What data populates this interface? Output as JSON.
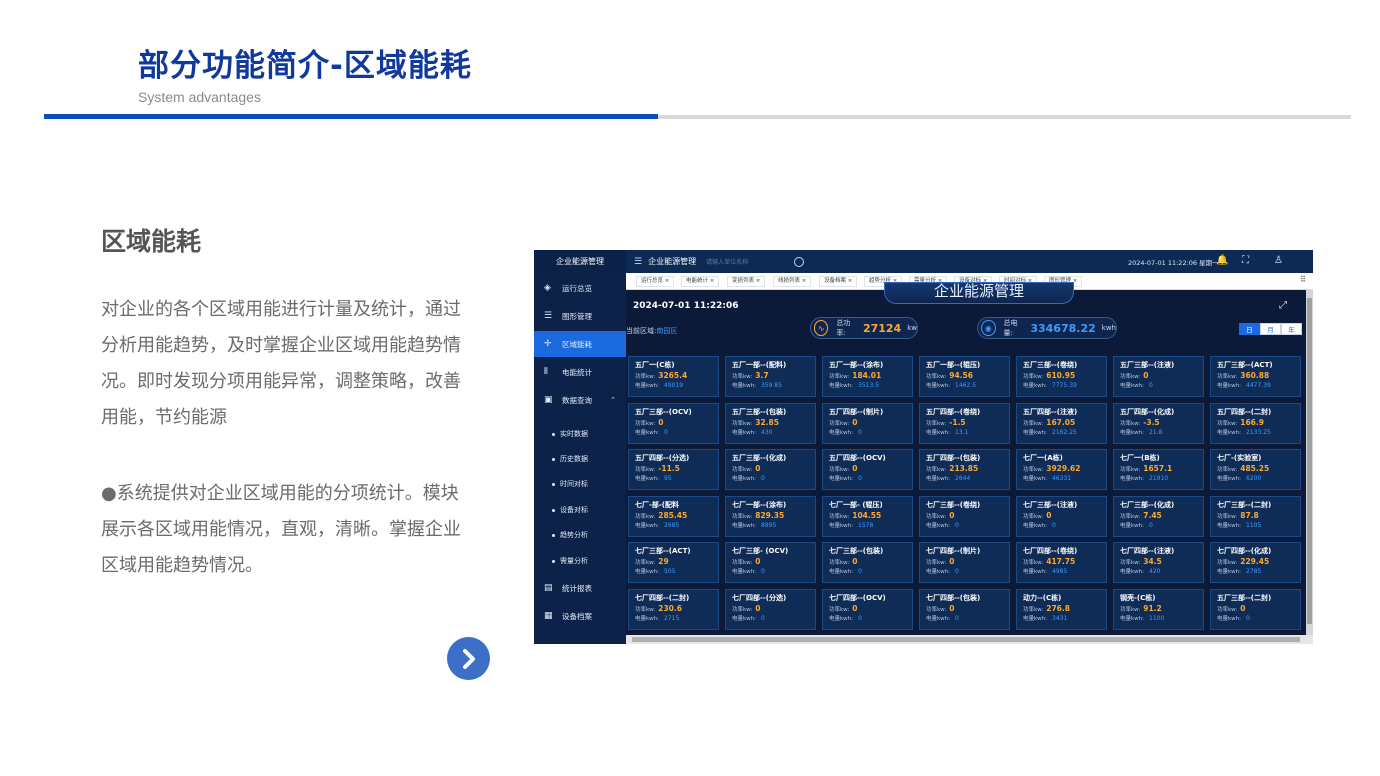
{
  "slide": {
    "title": "部分功能简介-区域能耗",
    "subtitle": "System advantages",
    "section_title": "区域能耗",
    "paragraph1": "对企业的各个区域用能进行计量及统计，通过分析用能趋势，及时掌握企业区域用能趋势情况。即时发现分项用能异常，调整策略，改善用能，节约能源",
    "paragraph2": "●系统提供对企业区域用能的分项统计。模块展示各区域用能情况，直观，清晰。掌握企业区域用能趋势情况。",
    "next_icon": "chevron-right-icon",
    "accent_color": "#0a4fb8"
  },
  "app": {
    "brand": "企业能源管理",
    "app_name": "企业能源管理",
    "search_placeholder": "请输入单位名称",
    "datetime": "2024-07-01 11:22:06 星期一",
    "sidebar": [
      {
        "label": "运行总览",
        "icon": "layers-icon"
      },
      {
        "label": "图形管理",
        "icon": "list-icon"
      },
      {
        "label": "区域能耗",
        "icon": "crosshair-icon",
        "active": true
      },
      {
        "label": "电能统计",
        "icon": "bar-icon"
      },
      {
        "label": "数据查询",
        "icon": "monitor-icon"
      },
      {
        "label": "实时数据"
      },
      {
        "label": "历史数据"
      },
      {
        "label": "时间对标"
      },
      {
        "label": "设备对标"
      },
      {
        "label": "趋势分析"
      },
      {
        "label": "需量分析"
      },
      {
        "label": "统计报表",
        "icon": "report-icon"
      },
      {
        "label": "设备档案",
        "icon": "archive-icon"
      }
    ],
    "tabs": [
      "运行总览 ×",
      "电能统计 ×",
      "变损列表 ×",
      "线损列表 ×",
      "设备档案 ×",
      "趋势分析 ×",
      "需量分析 ×",
      "设备对标 ×",
      "时间对标 ×",
      "图形管理 ×"
    ],
    "dashboard": {
      "datetime": "2024-07-01 11:22:06",
      "title": "企业能源管理",
      "region_label": "当前区域:",
      "region_value": "南园区",
      "total_power_label": "总功率:",
      "total_power": "27124",
      "total_power_unit": "kw",
      "total_energy_label": "总电量:",
      "total_energy": "334678.22",
      "total_energy_unit": "kwh",
      "periods": [
        "日",
        "月",
        "年"
      ],
      "power_label": "功率kw:",
      "energy_label": "电量kwh:",
      "cards": [
        {
          "name": "五厂一(C栋)",
          "power": "3265.4",
          "energy": "49019"
        },
        {
          "name": "五厂一部--(配料)",
          "power": "3.7",
          "energy": "359.85"
        },
        {
          "name": "五厂一部--(涂布)",
          "power": "184.01",
          "energy": "3513.5"
        },
        {
          "name": "五厂一部--(辊压)",
          "power": "94.56",
          "energy": "1462.5"
        },
        {
          "name": "五厂三部--(卷绕)",
          "power": "610.95",
          "energy": "7775.39"
        },
        {
          "name": "五厂三部--(注液)",
          "power": "0",
          "energy": "0"
        },
        {
          "name": "五厂三部--(ACT)",
          "power": "360.88",
          "energy": "4477.39"
        },
        {
          "name": "五厂三部--(OCV)",
          "power": "0",
          "energy": "0"
        },
        {
          "name": "五厂三部--(包装)",
          "power": "32.85",
          "energy": "430"
        },
        {
          "name": "五厂四部--(制片)",
          "power": "0",
          "energy": "0"
        },
        {
          "name": "五厂四部--(卷绕)",
          "power": "-1.5",
          "energy": "13.1"
        },
        {
          "name": "五厂四部--(注液)",
          "power": "167.05",
          "energy": "2162.25"
        },
        {
          "name": "五厂四部--(化成)",
          "power": "-3.5",
          "energy": "21.8"
        },
        {
          "name": "五厂四部--(二封)",
          "power": "166.9",
          "energy": "2133.25"
        },
        {
          "name": "五厂四部--(分选)",
          "power": "-11.5",
          "energy": "95"
        },
        {
          "name": "五厂三部--(化成)",
          "power": "0",
          "energy": "0"
        },
        {
          "name": "五厂四部--(OCV)",
          "power": "0",
          "energy": "0"
        },
        {
          "name": "五厂四部--(包装)",
          "power": "213.85",
          "energy": "2644"
        },
        {
          "name": "七厂一(A栋)",
          "power": "3929.62",
          "energy": "46331"
        },
        {
          "name": "七厂一(B栋)",
          "power": "1657.1",
          "energy": "21910"
        },
        {
          "name": "七厂-(实验室)",
          "power": "485.25",
          "energy": "6200"
        },
        {
          "name": "七厂-部-(配料",
          "power": "285.45",
          "energy": "2685"
        },
        {
          "name": "七厂一部--(涂布)",
          "power": "829.35",
          "energy": "8895"
        },
        {
          "name": "七厂一部- (辊压)",
          "power": "104.55",
          "energy": "1578"
        },
        {
          "name": "七厂三部--(卷绕)",
          "power": "0",
          "energy": "0"
        },
        {
          "name": "七厂三部--(注液)",
          "power": "0",
          "energy": "0"
        },
        {
          "name": "七厂三部--(化成)",
          "power": "7.45",
          "energy": "0"
        },
        {
          "name": "七厂三部--(二封)",
          "power": "87.8",
          "energy": "1105"
        },
        {
          "name": "七厂三部--(ACT)",
          "power": "29",
          "energy": "505"
        },
        {
          "name": "七厂三部- (OCV)",
          "power": "0",
          "energy": "0"
        },
        {
          "name": "七厂三部--(包装)",
          "power": "0",
          "energy": "0"
        },
        {
          "name": "七厂四部--(制片)",
          "power": "0",
          "energy": "0"
        },
        {
          "name": "七厂四部--(卷绕)",
          "power": "417.75",
          "energy": "4985"
        },
        {
          "name": "七厂四部--(注液)",
          "power": "34.5",
          "energy": "420"
        },
        {
          "name": "七厂四部--(化成)",
          "power": "229.45",
          "energy": "2785"
        },
        {
          "name": "七厂四部--(二封)",
          "power": "230.6",
          "energy": "2715"
        },
        {
          "name": "七厂四部--(分选)",
          "power": "0",
          "energy": "0"
        },
        {
          "name": "七厂四部--(OCV)",
          "power": "0",
          "energy": "0"
        },
        {
          "name": "七厂四部--(包装)",
          "power": "0",
          "energy": "0"
        },
        {
          "name": "动力--(C栋)",
          "power": "276.8",
          "energy": "3431"
        },
        {
          "name": "钢壳-(C栋)",
          "power": "91.2",
          "energy": "1100"
        },
        {
          "name": "五厂三部--(二封)",
          "power": "0",
          "energy": "0"
        }
      ]
    }
  }
}
